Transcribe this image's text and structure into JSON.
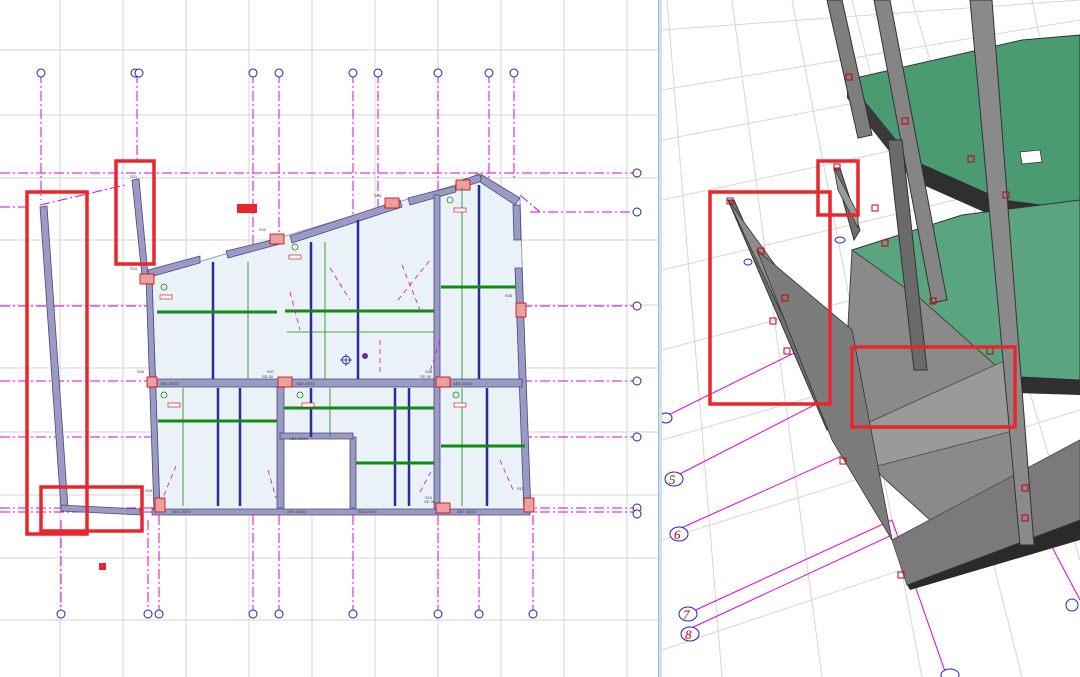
{
  "app": {
    "left_view": "plan-view",
    "right_view": "3d-view"
  },
  "colors": {
    "grid": "#cfcfcf",
    "axis": "#e000e0",
    "highlight": "#e8262c",
    "wall": "#9a9ac4",
    "slab": "#eaf2f7",
    "beam_blue": "#2b2b9a",
    "beam_green": "#138a13",
    "concrete": "#7a7a7a",
    "glass": "#4a9a72"
  },
  "plan": {
    "labels": {
      "s01": "S01",
      "s02": "S02",
      "s03": "S03",
      "s04": "S04",
      "s05": "S05",
      "s06": "S06",
      "s07": "S07",
      "s08": "S08",
      "s09": "S09",
      "s10": "S10",
      "s11": "S11",
      "s12": "S12",
      "b1": "AB1  25/50",
      "b2": "AB2  25/50",
      "b3": "AB3  25/50",
      "b4": "AB4  25/50",
      "b5": "AB5  25/50",
      "b6": "AB6  25/50",
      "b7": "AB7  25/50",
      "b8": "AB8  25/50",
      "b9": "AB9  25/50",
      "sd1": "SD 30",
      "sd2": "SD 30",
      "sd3": "SD 30"
    }
  },
  "view3d": {
    "axis_labels": [
      "5",
      "6",
      "7",
      "8"
    ]
  }
}
